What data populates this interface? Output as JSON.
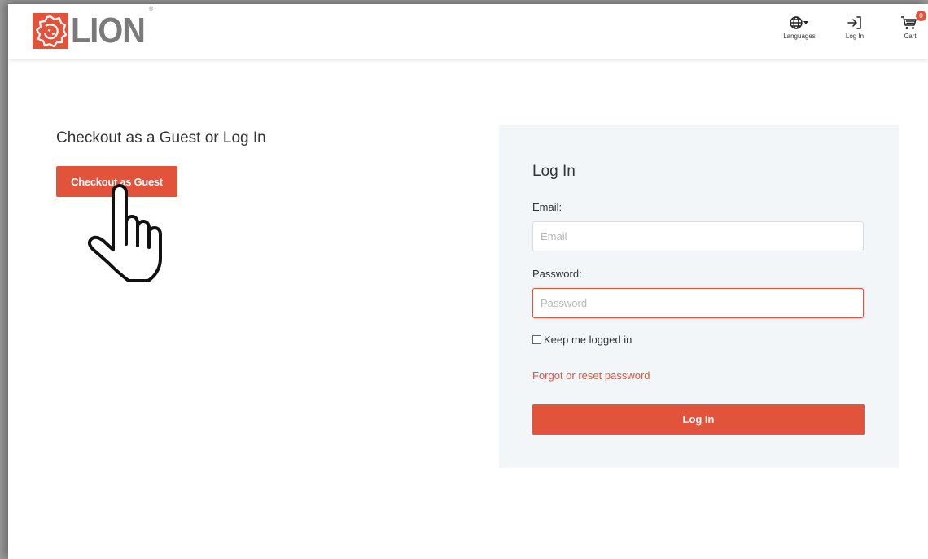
{
  "brand": {
    "name": "LION",
    "registered_mark": "®",
    "accent_color": "#e2533c"
  },
  "header": {
    "languages_label": "Languages",
    "login_label": "Log In",
    "cart_label": "Cart",
    "cart_count": "0"
  },
  "guest": {
    "title": "Checkout as a Guest or Log In",
    "button_label": "Checkout as Guest"
  },
  "login": {
    "title": "Log In",
    "email_label": "Email:",
    "email_placeholder": "Email",
    "email_value": "",
    "password_label": "Password:",
    "password_placeholder": "Password",
    "password_value": "",
    "keep_logged_in_label": "Keep me logged in",
    "keep_logged_in_checked": false,
    "forgot_label": "Forgot or reset password",
    "submit_label": "Log In"
  },
  "icons": {
    "logo": "lion-head-icon",
    "languages": "globe-icon",
    "login": "login-arrow-icon",
    "cart": "cart-icon",
    "pointer": "hand-pointer-icon"
  }
}
